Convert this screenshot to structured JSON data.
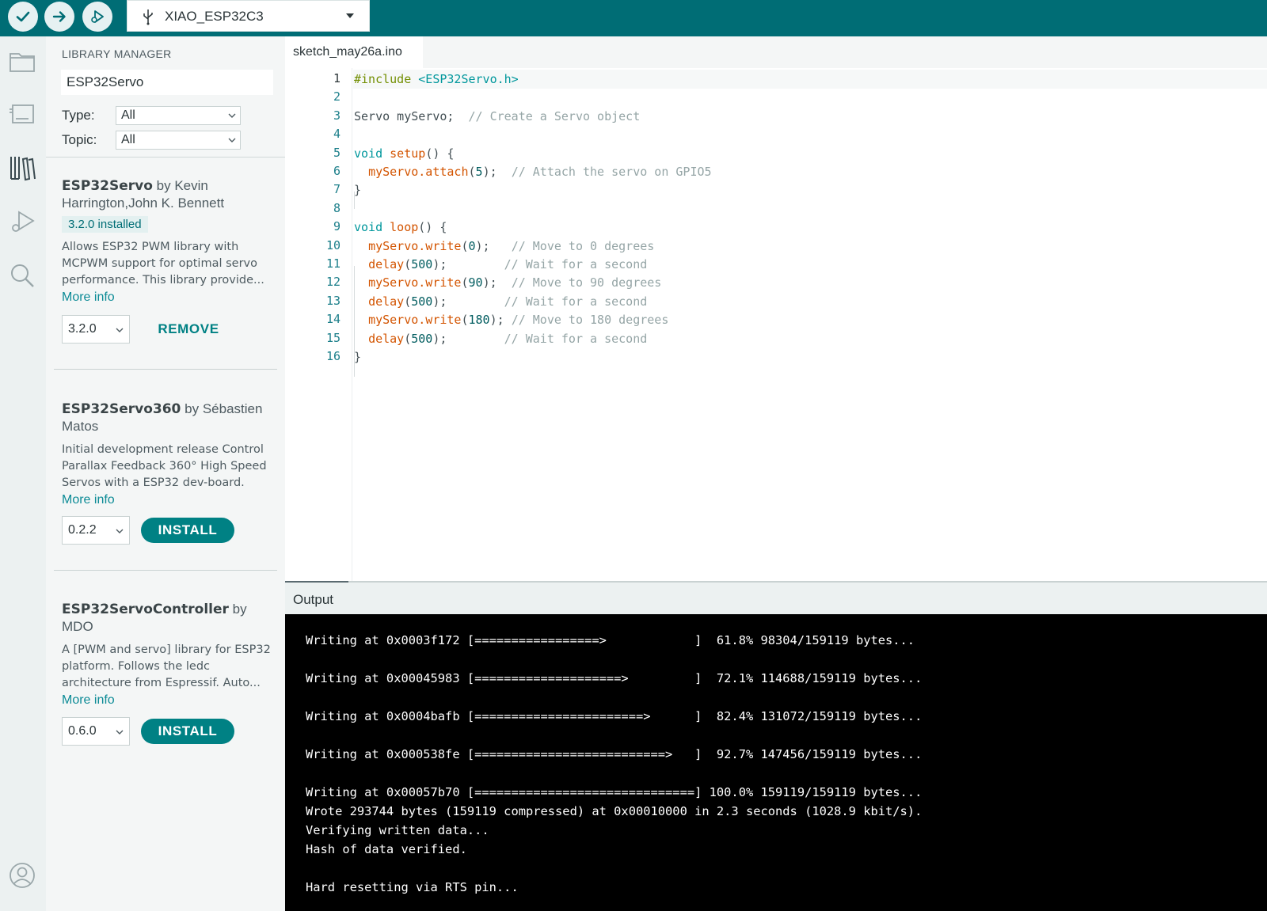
{
  "toolbar": {
    "verify_icon": "check-icon",
    "upload_icon": "arrow-right-icon",
    "debug_icon": "debug-icon",
    "board": "XIAO_ESP32C3"
  },
  "rail": [
    "folder-icon",
    "board-icon",
    "library-icon",
    "debug-icon",
    "search-icon",
    "account-icon"
  ],
  "library_manager": {
    "title": "LIBRARY MANAGER",
    "search_value": "ESP32Servo",
    "type_label": "Type:",
    "type_value": "All",
    "topic_label": "Topic:",
    "topic_value": "All",
    "items": [
      {
        "name": "ESP32Servo",
        "by": "by",
        "author": "Kevin Harrington,John K. Bennett",
        "badge": "3.2.0 installed",
        "description": "Allows ESP32 PWM library with MCPWM support for optimal servo performance. This library provide...",
        "more": "More info",
        "version": "3.2.0",
        "action": "REMOVE"
      },
      {
        "name": "ESP32Servo360",
        "by": "by",
        "author": "Sébastien Matos",
        "description": "Initial development release Control Parallax Feedback 360° High Speed Servos with a ESP32 dev-board.",
        "more": "More info",
        "version": "0.2.2",
        "action": "INSTALL"
      },
      {
        "name": "ESP32ServoController",
        "by": "by",
        "author": "MDO",
        "description": "A [PWM and servo] library for ESP32 platform. Follows the ledc architecture from Espressif. Auto...",
        "more": "More info",
        "version": "0.6.0",
        "action": "INSTALL"
      }
    ]
  },
  "editor": {
    "tab": "sketch_may26a.ino",
    "line_numbers": [
      "1",
      "2",
      "3",
      "4",
      "5",
      "6",
      "7",
      "8",
      "9",
      "10",
      "11",
      "12",
      "13",
      "14",
      "15",
      "16"
    ],
    "code": [
      [
        {
          "t": "pp",
          "v": "#include "
        },
        {
          "t": "kw",
          "v": "<ESP32Servo.h>"
        }
      ],
      [],
      [
        {
          "t": "",
          "v": "Servo myServo;  "
        },
        {
          "t": "cm",
          "v": "// Create a Servo object"
        }
      ],
      [],
      [
        {
          "t": "kw",
          "v": "void "
        },
        {
          "t": "fn",
          "v": "setup"
        },
        {
          "t": "",
          "v": "() {"
        }
      ],
      [
        {
          "t": "",
          "v": "  "
        },
        {
          "t": "fn",
          "v": "myServo.attach"
        },
        {
          "t": "",
          "v": "("
        },
        {
          "t": "nm",
          "v": "5"
        },
        {
          "t": "",
          "v": ");  "
        },
        {
          "t": "cm",
          "v": "// Attach the servo on GPIO5"
        }
      ],
      [
        {
          "t": "",
          "v": "}"
        }
      ],
      [],
      [
        {
          "t": "kw",
          "v": "void "
        },
        {
          "t": "fn",
          "v": "loop"
        },
        {
          "t": "",
          "v": "() {"
        }
      ],
      [
        {
          "t": "",
          "v": "  "
        },
        {
          "t": "fn",
          "v": "myServo.write"
        },
        {
          "t": "",
          "v": "("
        },
        {
          "t": "nm",
          "v": "0"
        },
        {
          "t": "",
          "v": ");   "
        },
        {
          "t": "cm",
          "v": "// Move to 0 degrees"
        }
      ],
      [
        {
          "t": "",
          "v": "  "
        },
        {
          "t": "fn",
          "v": "delay"
        },
        {
          "t": "",
          "v": "("
        },
        {
          "t": "nm",
          "v": "500"
        },
        {
          "t": "",
          "v": ");        "
        },
        {
          "t": "cm",
          "v": "// Wait for a second"
        }
      ],
      [
        {
          "t": "",
          "v": "  "
        },
        {
          "t": "fn",
          "v": "myServo.write"
        },
        {
          "t": "",
          "v": "("
        },
        {
          "t": "nm",
          "v": "90"
        },
        {
          "t": "",
          "v": ");  "
        },
        {
          "t": "cm",
          "v": "// Move to 90 degrees"
        }
      ],
      [
        {
          "t": "",
          "v": "  "
        },
        {
          "t": "fn",
          "v": "delay"
        },
        {
          "t": "",
          "v": "("
        },
        {
          "t": "nm",
          "v": "500"
        },
        {
          "t": "",
          "v": ");        "
        },
        {
          "t": "cm",
          "v": "// Wait for a second"
        }
      ],
      [
        {
          "t": "",
          "v": "  "
        },
        {
          "t": "fn",
          "v": "myServo.write"
        },
        {
          "t": "",
          "v": "("
        },
        {
          "t": "nm",
          "v": "180"
        },
        {
          "t": "",
          "v": "); "
        },
        {
          "t": "cm",
          "v": "// Move to 180 degrees"
        }
      ],
      [
        {
          "t": "",
          "v": "  "
        },
        {
          "t": "fn",
          "v": "delay"
        },
        {
          "t": "",
          "v": "("
        },
        {
          "t": "nm",
          "v": "500"
        },
        {
          "t": "",
          "v": ");        "
        },
        {
          "t": "cm",
          "v": "// Wait for a second"
        }
      ],
      [
        {
          "t": "",
          "v": "}"
        }
      ]
    ]
  },
  "output": {
    "label": "Output",
    "lines": [
      "Writing at 0x0003f172 [=================>            ]  61.8% 98304/159119 bytes...",
      "",
      "Writing at 0x00045983 [====================>         ]  72.1% 114688/159119 bytes...",
      "",
      "Writing at 0x0004bafb [=======================>      ]  82.4% 131072/159119 bytes...",
      "",
      "Writing at 0x000538fe [==========================>   ]  92.7% 147456/159119 bytes...",
      "",
      "Writing at 0x00057b70 [==============================] 100.0% 159119/159119 bytes...",
      "Wrote 293744 bytes (159119 compressed) at 0x00010000 in 2.3 seconds (1028.9 kbit/s).",
      "Verifying written data...",
      "Hash of data verified.",
      "",
      "Hard resetting via RTS pin..."
    ]
  },
  "colors": {
    "accent": "#006d75",
    "button": "#008184",
    "link": "#0c8b96"
  }
}
